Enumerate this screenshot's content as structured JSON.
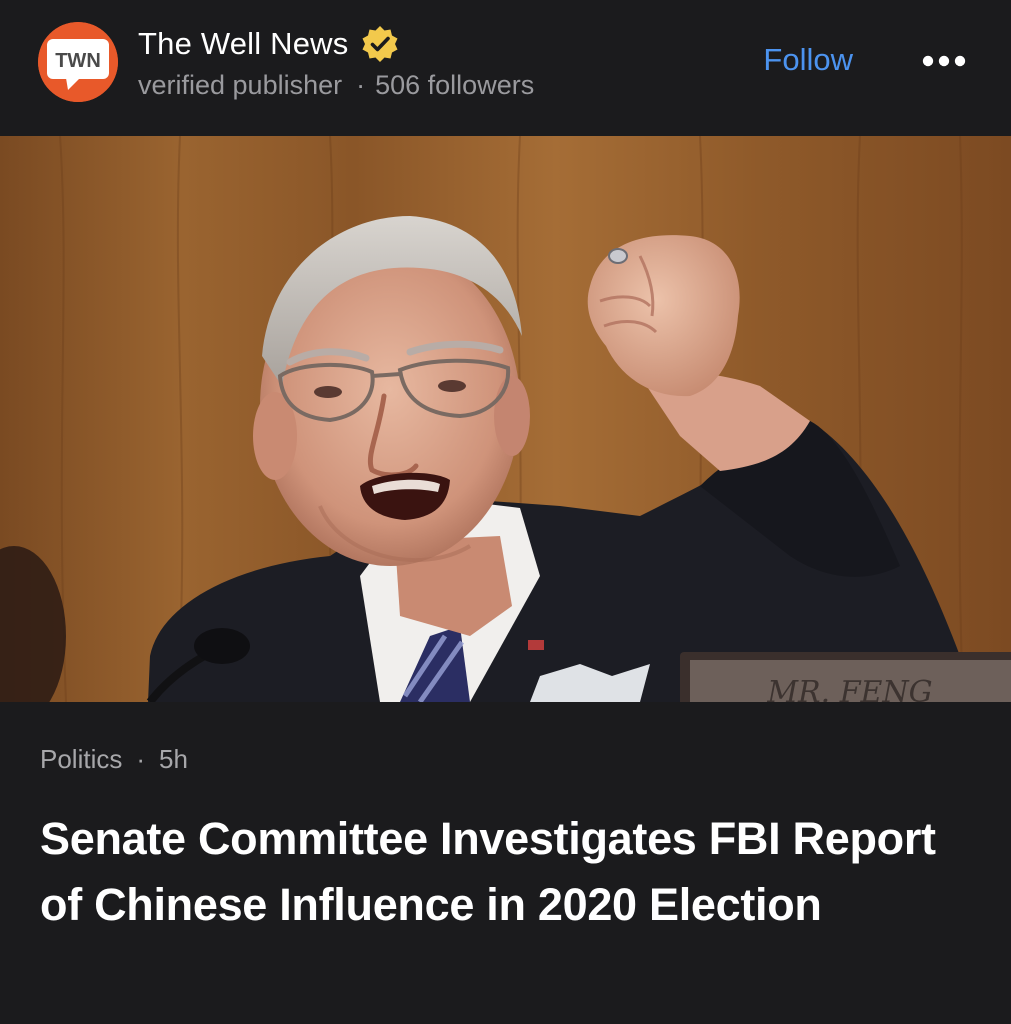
{
  "publisher": {
    "logo_text": "TWN",
    "name": "The Well News",
    "verified": true,
    "subtitle": "verified publisher",
    "separator": "·",
    "followers": "506 followers",
    "logo_color": "#e8592a",
    "verified_badge_color": "#f2c94c"
  },
  "actions": {
    "follow_label": "Follow",
    "follow_color": "#4c93ef",
    "more_icon": "more-horizontal-icon"
  },
  "hero": {
    "nameplate_text": "MR. FENG"
  },
  "article": {
    "category": "Politics",
    "separator": "·",
    "age": "5h",
    "headline": "Senate Committee Investigates FBI Report of Chinese Influence in 2020 Election"
  },
  "theme": {
    "background": "#1b1b1d",
    "secondary_text": "#9a9a9e"
  }
}
